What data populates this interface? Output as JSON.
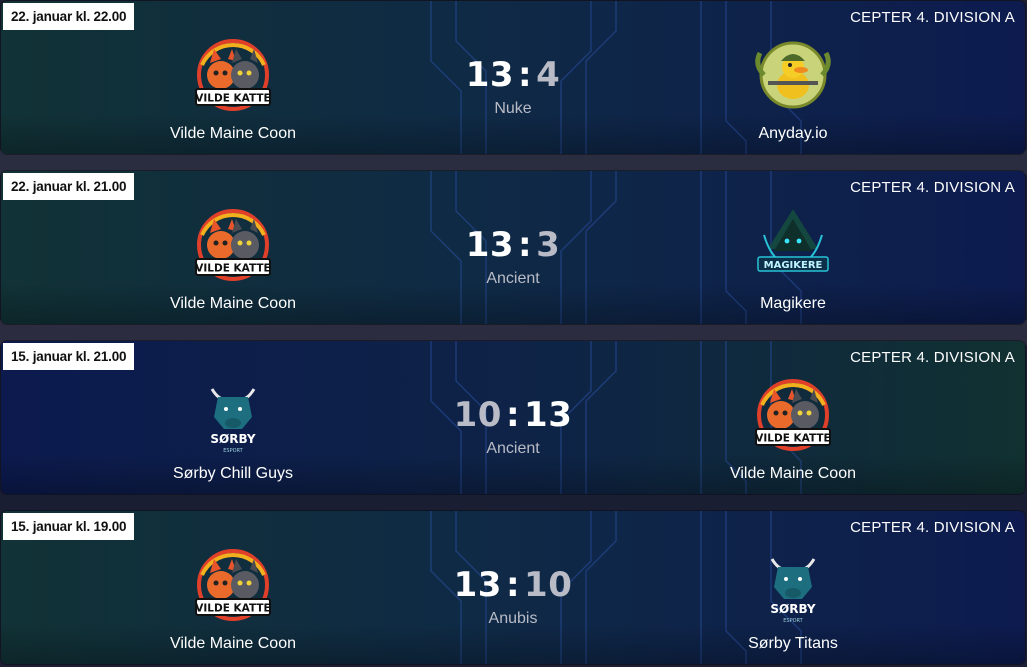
{
  "matches": [
    {
      "date": "22. januar kl. 22.00",
      "division": "CEPTER 4. DIVISION A",
      "home": {
        "name": "Vilde Maine Coon",
        "logo": "vilde-katte-logo",
        "logo_text": "VILDE KATTE"
      },
      "away": {
        "name": "Anyday.io",
        "logo": "duck-soldier-logo",
        "logo_text": ""
      },
      "home_score": "13",
      "away_score": "4",
      "separator": ":",
      "map": "Nuke",
      "winner": "home"
    },
    {
      "date": "22. januar kl. 21.00",
      "division": "CEPTER 4. DIVISION A",
      "home": {
        "name": "Vilde Maine Coon",
        "logo": "vilde-katte-logo",
        "logo_text": "VILDE KATTE"
      },
      "away": {
        "name": "Magikere",
        "logo": "magikere-wizard-logo",
        "logo_text": "MAGIKERE"
      },
      "home_score": "13",
      "away_score": "3",
      "separator": ":",
      "map": "Ancient",
      "winner": "home"
    },
    {
      "date": "15. januar kl. 21.00",
      "division": "CEPTER 4. DIVISION A",
      "home": {
        "name": "Sørby Chill Guys",
        "logo": "sorby-bull-logo",
        "logo_text": "SØRBY"
      },
      "away": {
        "name": "Vilde Maine Coon",
        "logo": "vilde-katte-logo",
        "logo_text": "VILDE KATTE"
      },
      "home_score": "10",
      "away_score": "13",
      "separator": ":",
      "map": "Ancient",
      "winner": "away"
    },
    {
      "date": "15. januar kl. 19.00",
      "division": "CEPTER 4. DIVISION A",
      "home": {
        "name": "Vilde Maine Coon",
        "logo": "vilde-katte-logo",
        "logo_text": "VILDE KATTE"
      },
      "away": {
        "name": "Sørby Titans",
        "logo": "sorby-bull-logo",
        "logo_text": "SØRBY"
      },
      "home_score": "13",
      "away_score": "10",
      "separator": ":",
      "map": "Anubis",
      "winner": "home"
    }
  ],
  "colors": {
    "win_score": "#ffffff",
    "lose_score": "#b9bcc6",
    "date_badge_bg": "#ffffff"
  }
}
